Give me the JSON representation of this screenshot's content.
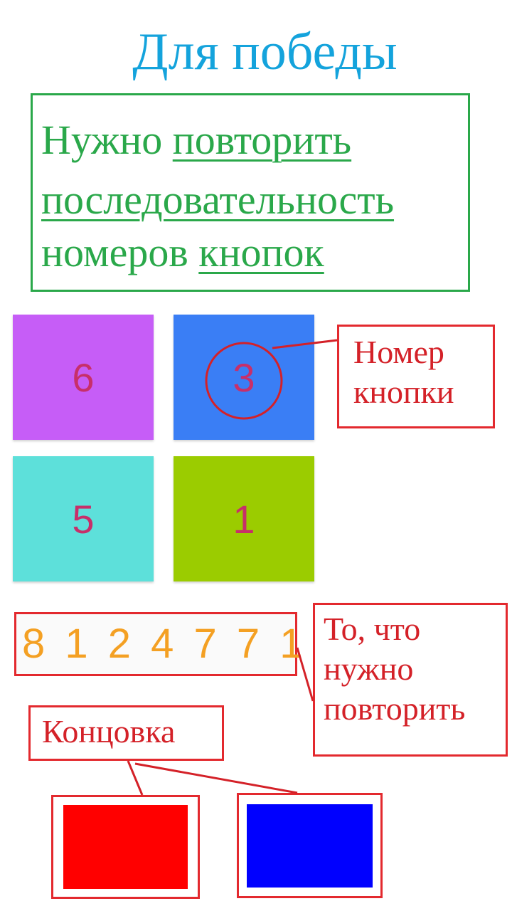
{
  "title": "Для победы",
  "instructions": {
    "line1_plain": "Нужно ",
    "line1_underlined": "повторить",
    "line2_underlined": "последовательность",
    "line3_plain": "номеров ",
    "line3_underlined": "кнопок"
  },
  "tiles": [
    {
      "number": "6",
      "color": "#c65df7"
    },
    {
      "number": "3",
      "color": "#3a7ef5"
    },
    {
      "number": "5",
      "color": "#5de0da"
    },
    {
      "number": "1",
      "color": "#9bcc00"
    }
  ],
  "sequence": "8 1 2 4 7 7 1",
  "annotations": {
    "button_number": {
      "line1": "Номер",
      "line2": "кнопки"
    },
    "to_repeat": {
      "line1": "То, что",
      "line2": "нужно",
      "line3": "повторить"
    },
    "ending": "Концовка"
  },
  "ending_colors": {
    "left": "#ff0000",
    "right": "#0000ff"
  },
  "accent_colors": {
    "title": "#14a3dc",
    "instructions": "#2aa84a",
    "annotation": "#e3292e",
    "tile_number": "#c72f6a",
    "sequence": "#f4a023"
  }
}
